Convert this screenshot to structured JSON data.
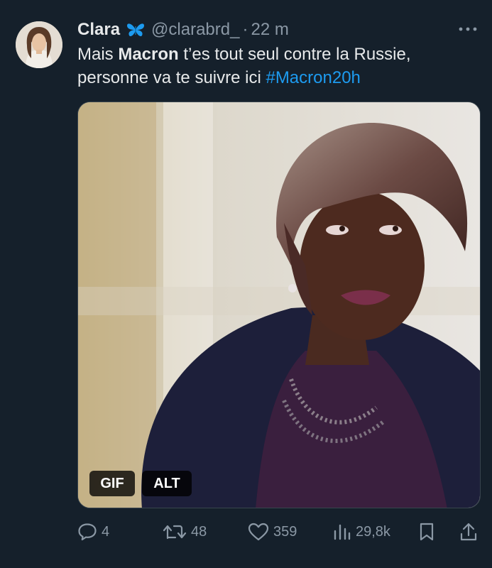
{
  "author": {
    "name": "Clara",
    "handle": "@clarabrd_",
    "separator": "·",
    "time": "22 m"
  },
  "tweet": {
    "text_part1": "Mais ",
    "text_bold": "Macron",
    "text_part2": " t’es tout seul contre la Russie, personne va te suivre ici ",
    "hashtag": "#Macron20h"
  },
  "media": {
    "gif_label": "GIF",
    "alt_label": "ALT"
  },
  "actions": {
    "replies": "4",
    "retweets": "48",
    "likes": "359",
    "views": "29,8k"
  },
  "icons": {
    "verified_badge": "butterfly-icon",
    "more": "more-icon",
    "reply": "reply-icon",
    "retweet": "retweet-icon",
    "like": "heart-icon",
    "views": "views-icon",
    "bookmark": "bookmark-icon",
    "share": "share-icon"
  },
  "colors": {
    "background": "#15202b",
    "text": "#e7e9ea",
    "secondary": "#8b98a5",
    "link": "#1d9bf0",
    "badge": "#1d9bf0"
  }
}
